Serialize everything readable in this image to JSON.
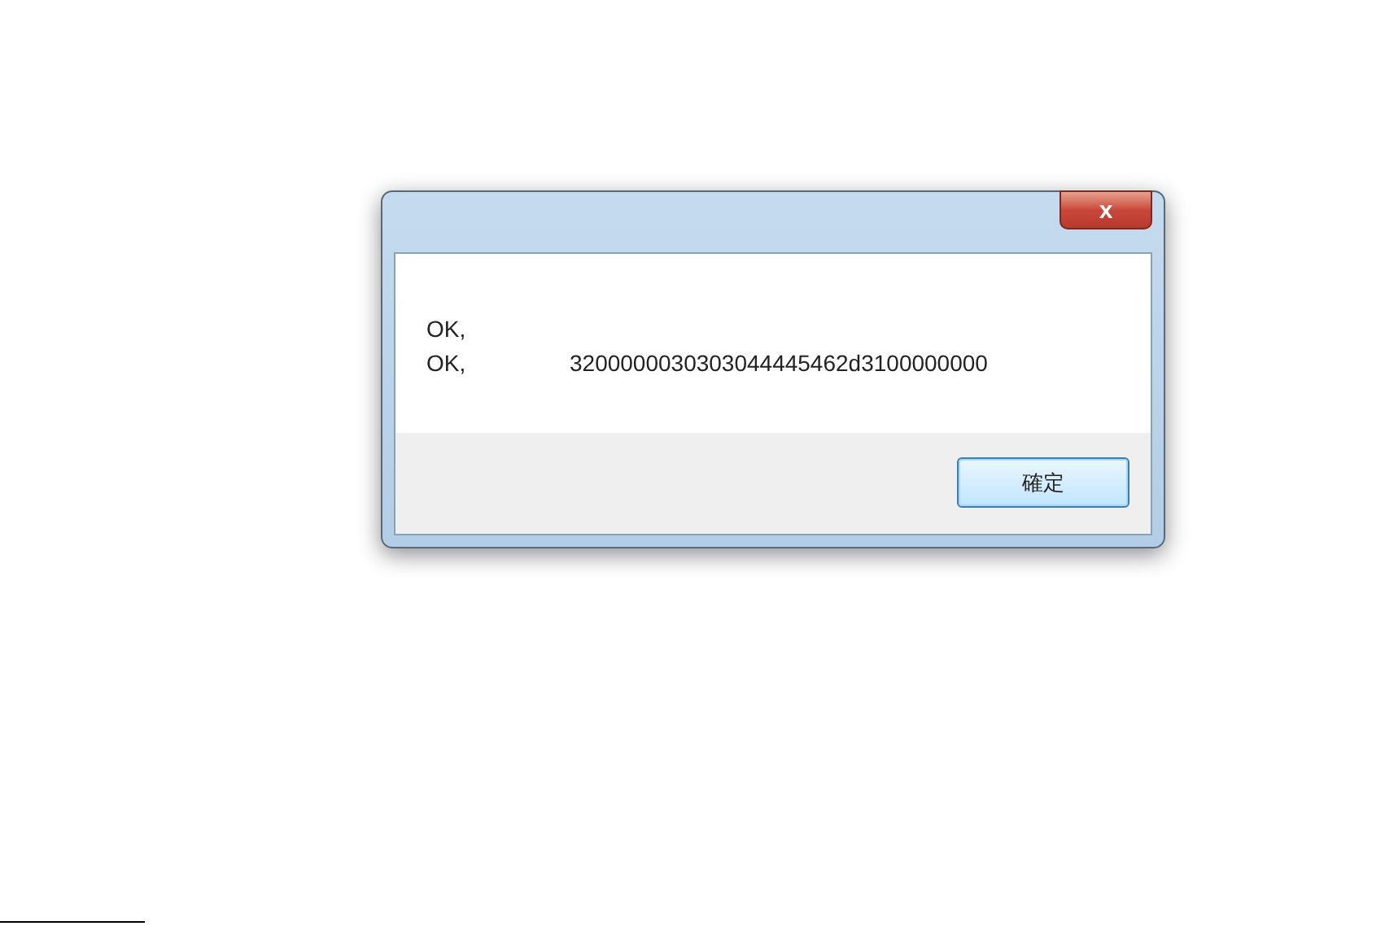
{
  "dialog": {
    "close_label": "x",
    "lines": [
      {
        "label": "OK,"
      },
      {
        "label": "OK,",
        "value": "3200000030303044445462d3100000000"
      }
    ],
    "buttons": [
      "確定"
    ]
  }
}
